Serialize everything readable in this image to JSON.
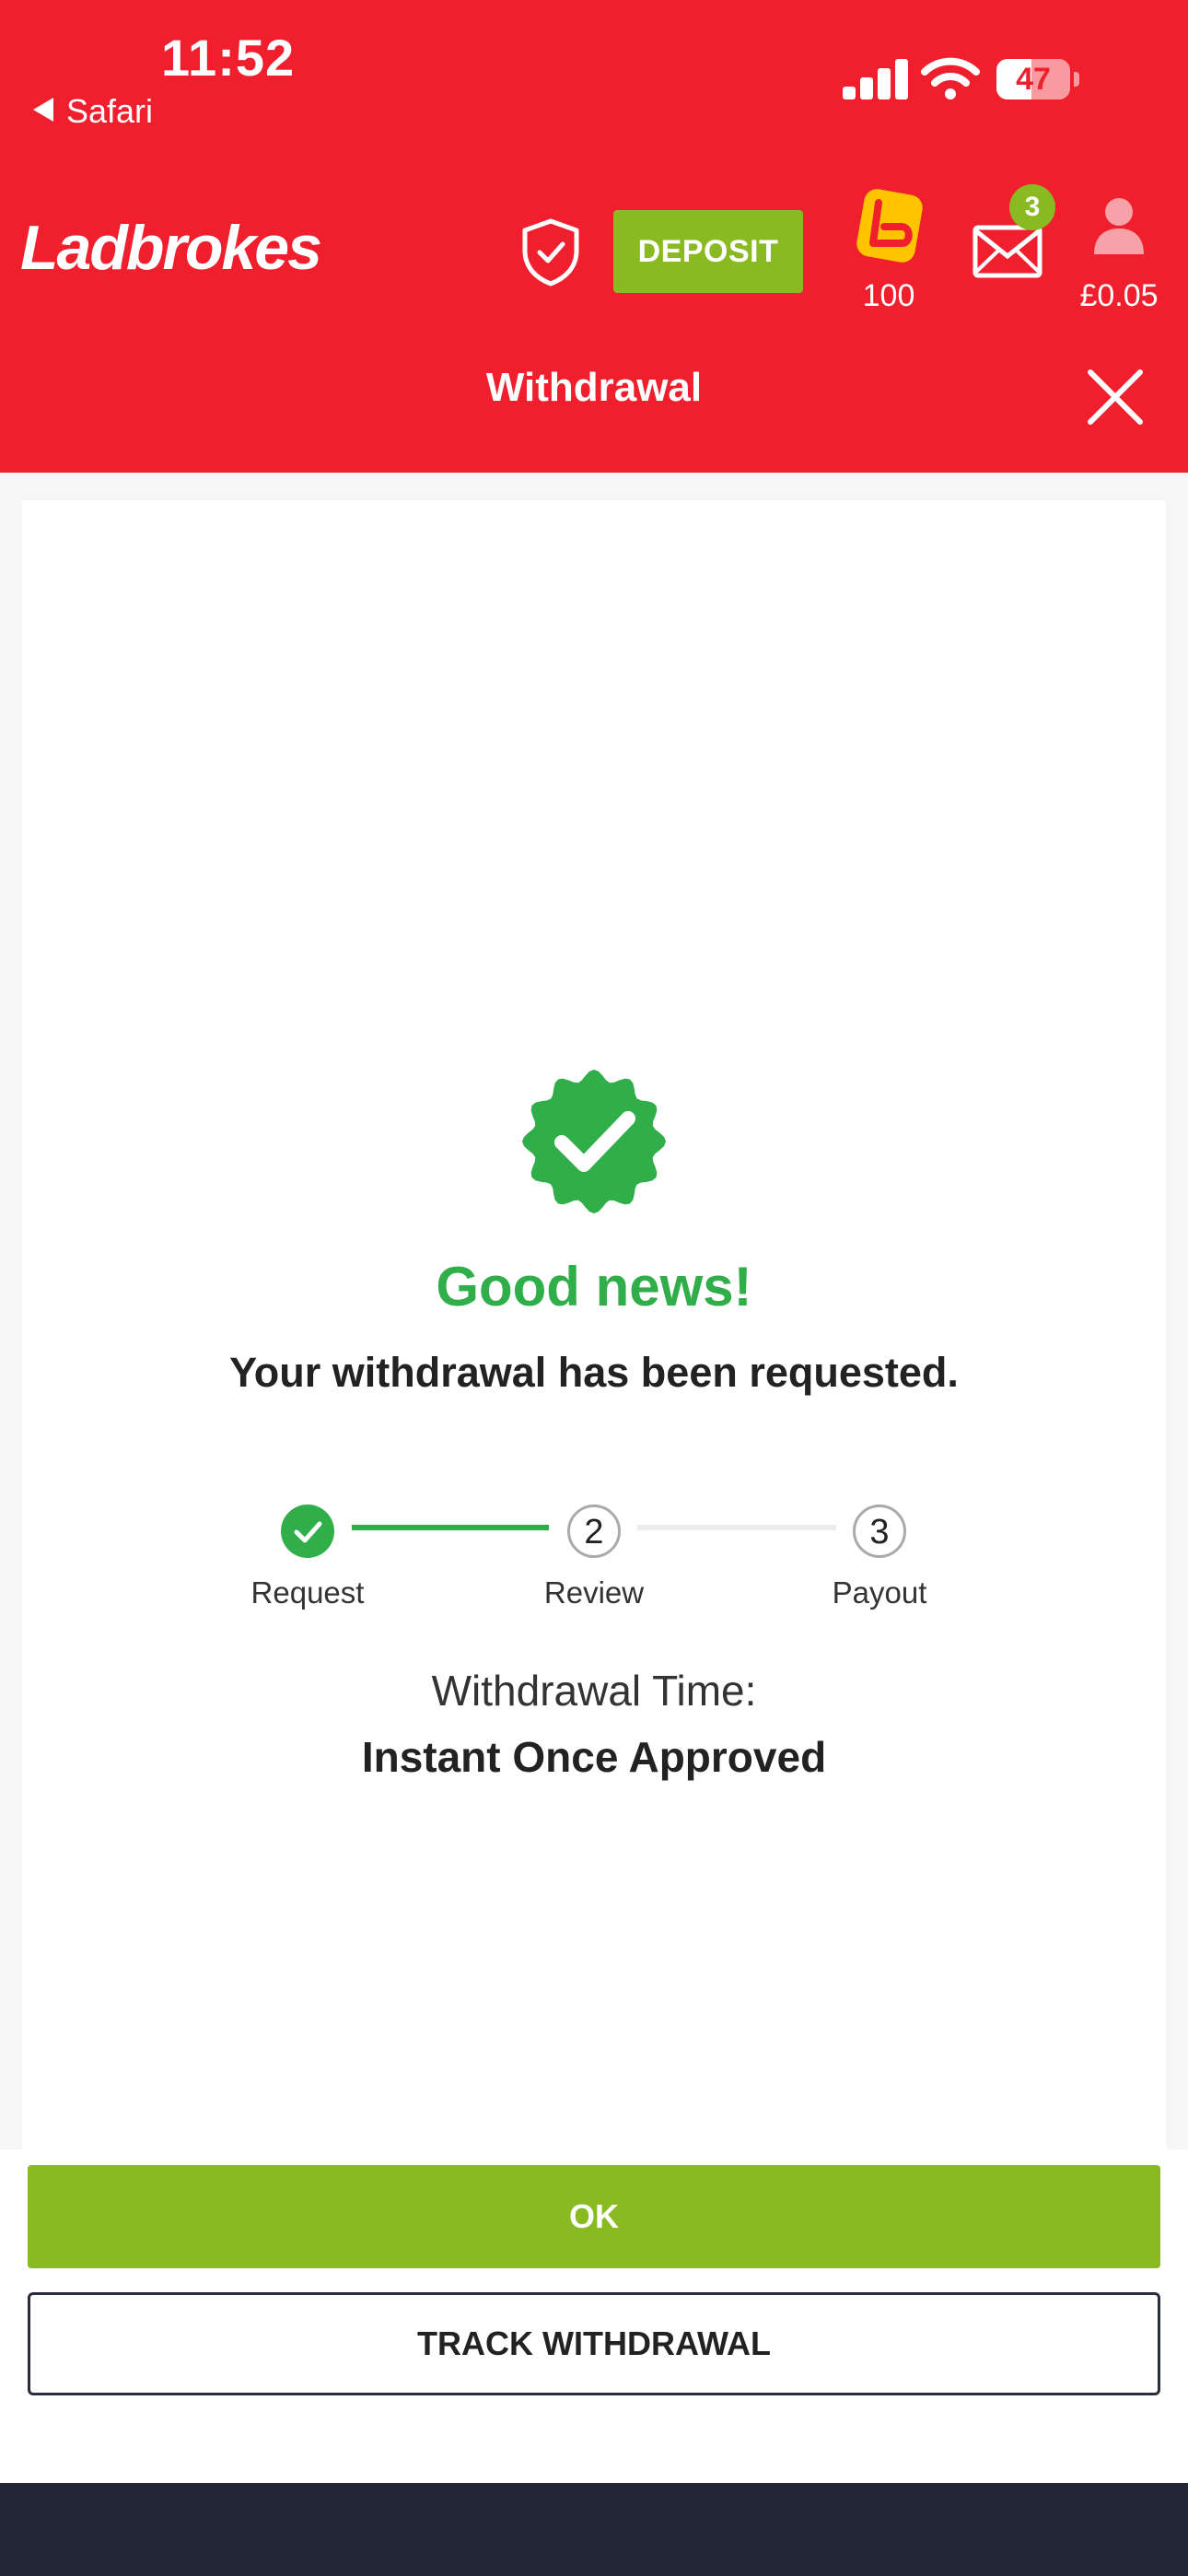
{
  "status_bar": {
    "time": "11:52",
    "back_label": "Safari",
    "battery": "47",
    "battery_level": 0.47
  },
  "header": {
    "brand": "Ladbrokes",
    "deposit_label": "DEPOSIT",
    "loyalty_count": "100",
    "messages_count": "3",
    "balance": "£0.05",
    "title": "Withdrawal"
  },
  "result": {
    "headline": "Good news!",
    "message": "Your withdrawal has been requested."
  },
  "steps": [
    {
      "number": "1",
      "label": "Request",
      "state": "complete"
    },
    {
      "number": "2",
      "label": "Review",
      "state": "pending"
    },
    {
      "number": "3",
      "label": "Payout",
      "state": "pending"
    }
  ],
  "withdrawal_time": {
    "label": "Withdrawal Time:",
    "value": "Instant Once Approved"
  },
  "actions": {
    "ok_label": "OK",
    "track_label": "TRACK WITHDRAWAL"
  },
  "colors": {
    "brand_red": "#ef1f2d",
    "accent_green": "#8aba22",
    "success_green": "#2fae49",
    "dark": "#232634"
  }
}
